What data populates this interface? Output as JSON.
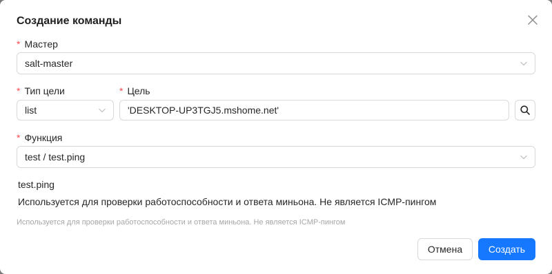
{
  "dialog": {
    "title": "Создание команды"
  },
  "form": {
    "required_mark": "*",
    "master": {
      "label": "Мастер",
      "value": "salt-master"
    },
    "target_type": {
      "label": "Тип цели",
      "value": "list"
    },
    "target": {
      "label": "Цель",
      "value": "'DESKTOP-UP3TGJ5.mshome.net'"
    },
    "function": {
      "label": "Функция",
      "value": "test / test.ping"
    }
  },
  "description": {
    "name": "test.ping",
    "text": "Используется для проверки работоспособности и ответа миньона. Не является ICMP-пингом",
    "hint": "Используется для проверки работоспособности и ответа миньона. Не является ICMP-пингом"
  },
  "footer": {
    "cancel_label": "Отмена",
    "create_label": "Создать"
  },
  "icons": {
    "close": "close-icon",
    "dropdown": "chevron-down-icon",
    "search": "search-icon"
  },
  "colors": {
    "primary": "#1677ff",
    "required": "#ff4d4f",
    "border": "#d9d9d9",
    "hint_text": "#a6a6a6"
  }
}
